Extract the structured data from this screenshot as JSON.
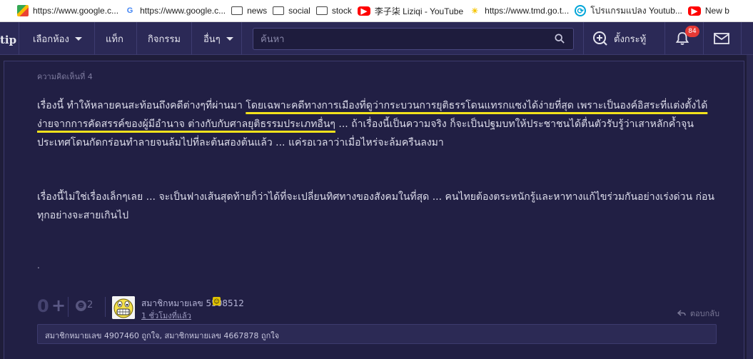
{
  "bookmarks": [
    {
      "label": "https://www.google.c...",
      "icon": "google-maps-icon"
    },
    {
      "label": "https://www.google.c...",
      "icon": "google-g-icon"
    },
    {
      "label": "news",
      "icon": "folder-icon"
    },
    {
      "label": "social",
      "icon": "folder-icon"
    },
    {
      "label": "stock",
      "icon": "folder-icon"
    },
    {
      "label": "李子柒 Liziqi - YouTube",
      "icon": "youtube-icon"
    },
    {
      "label": "https://www.tmd.go.t...",
      "icon": "sun-icon"
    },
    {
      "label": "โปรแกรมแปลง Youtub...",
      "icon": "circle-logo-icon"
    },
    {
      "label": "New b",
      "icon": "youtube-icon"
    }
  ],
  "navbar": {
    "logo": "tip",
    "select_room": "เลือกห้อง",
    "tag": "แท็ก",
    "activity": "กิจกรรม",
    "more": "อื่นๆ",
    "search_placeholder": "ค้นหา",
    "create_topic": "ตั้งกระทู้",
    "notification_count": "84"
  },
  "comment": {
    "number_label": "ความคิดเห็นที่ 4",
    "p1_a": "เรื่องนี้ ทำให้หลายคนสะท้อนถึงคดีต่างๆที่ผ่านมา ",
    "p1_highlight": "โดยเฉพาะคดีทางการเมืองที่ดูว่ากระบวนการยุติธรรโดนแทรกแซงได้ง่ายที่สุด เพราะเป็นองค์อิสระที่แต่งตั้งได้ง่ายจากการคัดสรรค์ของผู้มีอำนาจ ต่างกับกับศาลยุติธรรมประเภทอื่นๆ",
    "p1_b": " ... ถ้าเรื่องนี้เป็นความจริง ก็จะเป็นปฐมบทให้ประชาชนได้ตื่นตัวรับรู้ว่าเสาหลักค้ำจุนประเทศโดนกัดกร่อนทำลายจนล้มไปที่ละต้นสองต้นแล้ว ... แค่รอเวลาว่าเมื่อไหร่จะล้มครืนลงมา",
    "p2": "เรื่องนี้ไม่ใช่เรื่องเล็กๆเลย ... จะเป็นฟางเส้นสุดท้ายก็ว่าได้ที่จะเปลี่ยนทิศทางของสังคมในที่สุด ... คนไทยต้องตระหนักรู้และหาทางแก้ไขร่วมกันอย่างเร่งด่วน ก่อนทุกอย่างจะสายเกินไป",
    "trailing": ".",
    "score": "0",
    "emotion_count": "2",
    "author": "สมาชิกหมายเลข 5508512",
    "time": "1 ชั่วโมงที่แล้ว",
    "reply": "ตอบกลับ",
    "likes": "สมาชิกหมายเลข 4907460 ถูกใจ, สมาชิกหมายเลข 4667878 ถูกใจ"
  },
  "colors": {
    "background": "#1f1d3a",
    "navbar": "#2b2956",
    "highlight_underline": "#f2e21c",
    "badge": "#e53935"
  }
}
